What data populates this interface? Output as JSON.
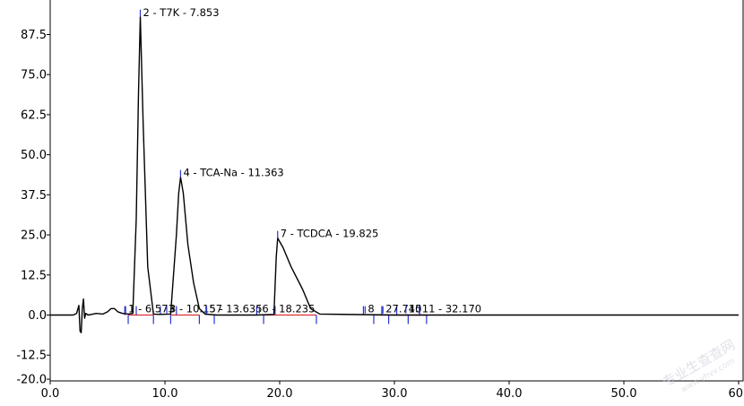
{
  "chart_data": {
    "type": "line",
    "title": "",
    "xlabel": "",
    "ylabel": "",
    "xlim": [
      0,
      60
    ],
    "ylim": [
      -20,
      100
    ],
    "x_ticks": [
      0.0,
      10.0,
      20.0,
      30.0,
      40.0,
      50.0,
      60.0
    ],
    "x_tick_labels": [
      "0.0",
      "10.0",
      "20.0",
      "30.0",
      "40.0",
      "50.0",
      "60"
    ],
    "y_ticks": [
      -20.0,
      -12.5,
      0.0,
      12.5,
      25.0,
      37.5,
      50.0,
      62.5,
      75.0,
      87.5
    ],
    "y_tick_labels": [
      "-20.0",
      "-12.5",
      "0.0",
      "12.5",
      "25.0",
      "37.5",
      "50.0",
      "62.5",
      "75.0",
      "87.5"
    ],
    "series": [
      {
        "color": "#000000",
        "x": [
          0.0,
          2.0,
          2.3,
          2.5,
          2.6,
          2.7,
          2.8,
          2.9,
          3.0,
          3.1,
          3.3,
          3.6,
          4.0,
          4.6,
          5.0,
          5.3,
          5.6,
          5.9,
          6.3,
          6.8,
          7.2,
          7.5,
          7.7,
          7.853,
          8.1,
          8.5,
          9.0,
          9.5,
          10.5,
          11.0,
          11.2,
          11.363,
          11.6,
          12.0,
          12.5,
          13.0,
          13.5,
          14.5,
          16.0,
          18.0,
          19.5,
          19.7,
          19.825,
          20.3,
          21.0,
          22.0,
          22.7,
          23.5,
          30.0,
          40.0,
          50.0,
          60.0
        ],
        "y": [
          0.0,
          0.0,
          0.5,
          3.0,
          -5.0,
          -5.5,
          2.0,
          5.0,
          -1.0,
          0.5,
          0.0,
          0.2,
          0.5,
          0.3,
          1.0,
          2.0,
          2.0,
          1.0,
          0.5,
          0.3,
          0.5,
          30.0,
          70.0,
          93.0,
          60.0,
          15.0,
          0.3,
          0.2,
          0.3,
          25.0,
          38.0,
          43.0,
          38.0,
          22.0,
          10.0,
          2.0,
          0.3,
          0.0,
          0.0,
          0.0,
          0.2,
          18.0,
          24.0,
          21.0,
          15.0,
          8.0,
          2.0,
          0.3,
          0.0,
          0.0,
          0.0,
          0.0
        ]
      }
    ],
    "peak_annotations": [
      {
        "x": 7.853,
        "y": 93.0,
        "label": "2 - T7K - 7.853"
      },
      {
        "x": 11.363,
        "y": 43.0,
        "label": "4 - TCA-Na - 11.363"
      },
      {
        "x": 19.825,
        "y": 24.0,
        "label": "7 - TCDCA - 19.825"
      },
      {
        "x": 6.573,
        "y": 0.5,
        "label": "1 - 6.573"
      },
      {
        "x": 10.157,
        "y": 0.5,
        "label": "3 - 10.157"
      },
      {
        "x": 13.635,
        "y": 0.5,
        "label": "5 - 13.635"
      },
      {
        "x": 18.235,
        "y": 0.5,
        "label": "6 - 18.235"
      },
      {
        "x": 27.45,
        "y": 0.5,
        "label": "8"
      },
      {
        "x": 29.0,
        "y": 0.5,
        "label": "27.745"
      },
      {
        "x": 31.0,
        "y": 0.5,
        "label": "10"
      },
      {
        "x": 32.17,
        "y": 0.5,
        "label": "11 - 32.170"
      }
    ],
    "integration_marks": [
      6.5,
      6.8,
      7.5,
      9.0,
      9.6,
      10.5,
      11.0,
      13.0,
      13.6,
      14.3,
      18.0,
      18.6,
      19.6,
      23.2,
      27.3,
      28.2,
      28.9,
      29.5,
      30.2,
      31.2,
      32.2,
      32.8
    ],
    "baseline_segments": [
      [
        6.8,
        9.0
      ],
      [
        10.5,
        13.0
      ],
      [
        18.6,
        23.2
      ],
      [
        28.2,
        32.8
      ]
    ],
    "grid": false,
    "legend": "none"
  },
  "watermark": {
    "text1": "专业生查查网",
    "text2": "www.yhvv.com"
  }
}
